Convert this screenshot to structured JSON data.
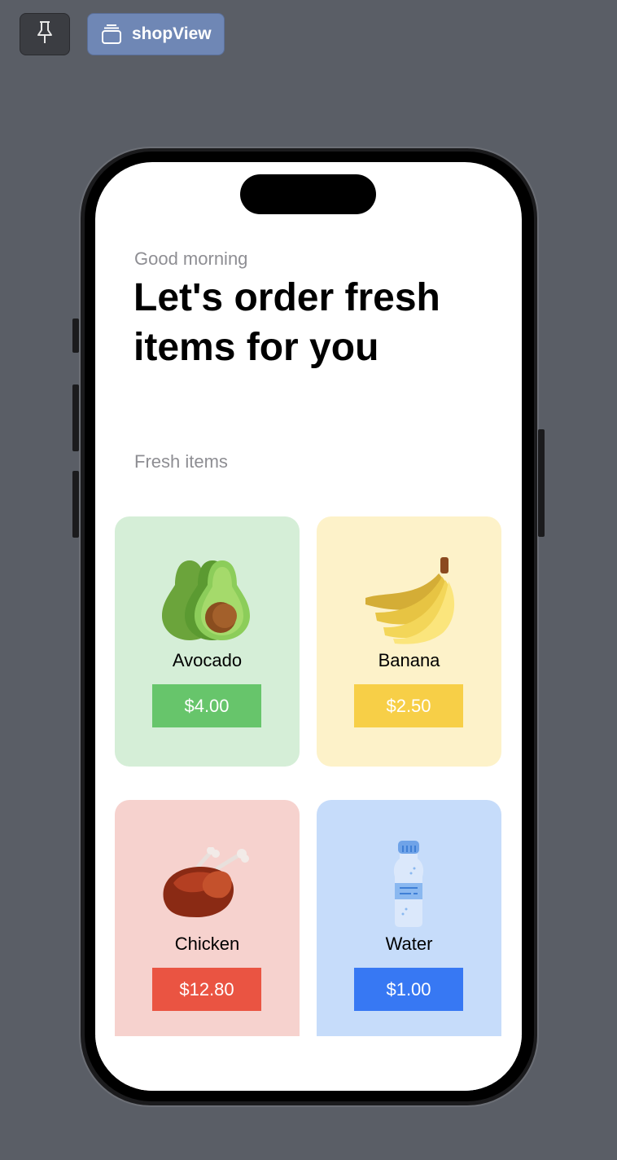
{
  "toolbar": {
    "pin_icon": "pin-icon",
    "preview_icon": "stack-icon",
    "preview_label": "shopView"
  },
  "header": {
    "greeting": "Good morning",
    "title": "Let's order fresh items for you"
  },
  "section": {
    "label": "Fresh items"
  },
  "items": [
    {
      "name": "Avocado",
      "price": "$4.00",
      "icon": "avocado-icon",
      "card_color": "#d5eed7",
      "button_color": "#67c56b"
    },
    {
      "name": "Banana",
      "price": "$2.50",
      "icon": "banana-icon",
      "card_color": "#fdf2c9",
      "button_color": "#f7cf47"
    },
    {
      "name": "Chicken",
      "price": "$12.80",
      "icon": "chicken-icon",
      "card_color": "#f6d2ce",
      "button_color": "#ea5442"
    },
    {
      "name": "Water",
      "price": "$1.00",
      "icon": "water-bottle-icon",
      "card_color": "#c6dcfa",
      "button_color": "#3778f3"
    }
  ]
}
